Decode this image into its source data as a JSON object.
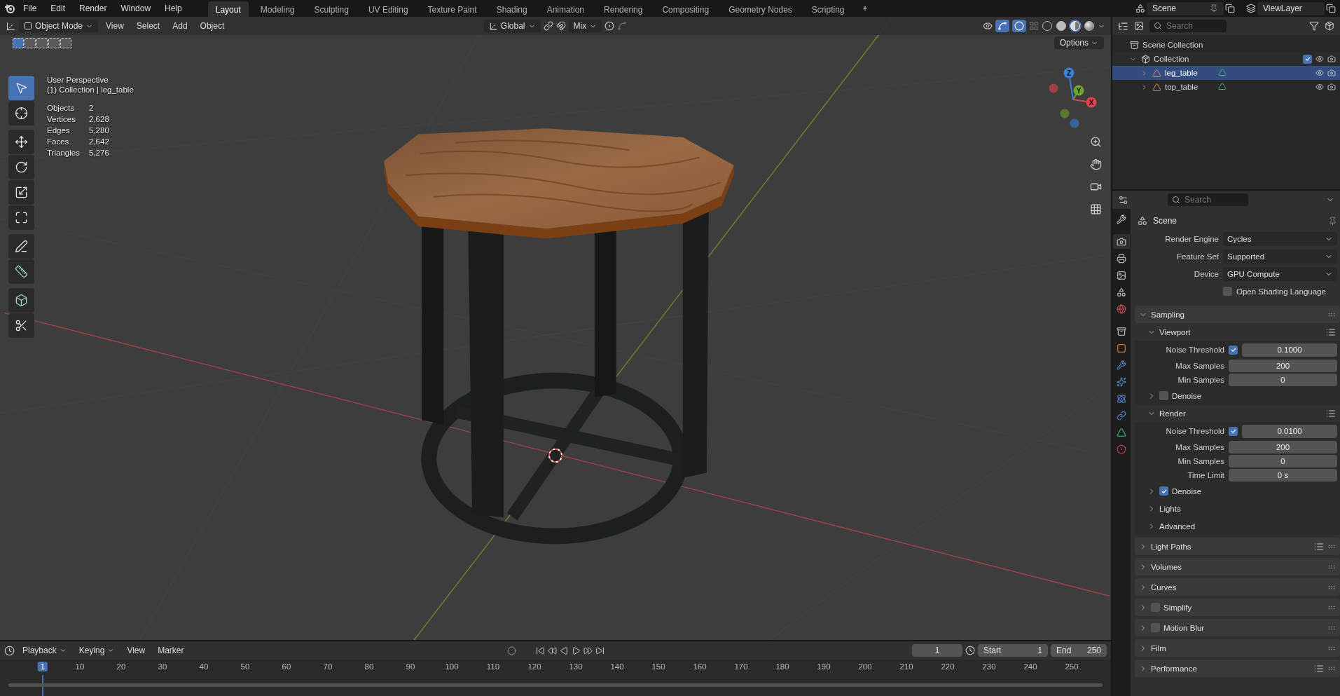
{
  "menu": [
    "File",
    "Edit",
    "Render",
    "Window",
    "Help"
  ],
  "workspaces": [
    {
      "label": "Layout",
      "selected": true
    },
    {
      "label": "Modeling",
      "selected": false
    },
    {
      "label": "Sculpting",
      "selected": false
    },
    {
      "label": "UV Editing",
      "selected": false
    },
    {
      "label": "Texture Paint",
      "selected": false
    },
    {
      "label": "Shading",
      "selected": false
    },
    {
      "label": "Animation",
      "selected": false
    },
    {
      "label": "Rendering",
      "selected": false
    },
    {
      "label": "Compositing",
      "selected": false
    },
    {
      "label": "Geometry Nodes",
      "selected": false
    },
    {
      "label": "Scripting",
      "selected": false
    }
  ],
  "add_workspace": "+",
  "scene_field": "Scene",
  "view_layer_field": "ViewLayer",
  "viewport": {
    "mode": "Object Mode",
    "menus": [
      "View",
      "Select",
      "Add",
      "Object"
    ],
    "orientation": "Global",
    "snap_mode": "Mix",
    "options": "Options",
    "select_modes": [
      {
        "selected": true
      },
      {
        "selected": false
      },
      {
        "selected": false
      },
      {
        "selected": false
      },
      {
        "selected": false
      }
    ],
    "shading": [
      {
        "kind": "wire",
        "selected": false
      },
      {
        "kind": "solid",
        "selected": false
      },
      {
        "kind": "material",
        "selected": true
      },
      {
        "kind": "rendered",
        "selected": false
      }
    ],
    "view_name": "User Perspective",
    "context": "(1) Collection | leg_table",
    "stats": [
      {
        "label": "Objects",
        "value": "2"
      },
      {
        "label": "Vertices",
        "value": "2,628"
      },
      {
        "label": "Edges",
        "value": "5,280"
      },
      {
        "label": "Faces",
        "value": "2,642"
      },
      {
        "label": "Triangles",
        "value": "5,276"
      }
    ],
    "tools": [
      {
        "kind": "select",
        "selected": true
      },
      {
        "kind": "cursor",
        "selected": false
      },
      {
        "kind": "move",
        "selected": false
      },
      {
        "kind": "rotate",
        "selected": false
      },
      {
        "kind": "scale",
        "selected": false
      },
      {
        "kind": "transform",
        "selected": false
      },
      {
        "kind": "annotate",
        "selected": false
      },
      {
        "kind": "measure",
        "selected": false
      },
      {
        "kind": "add_cube",
        "selected": false
      },
      {
        "kind": "cut",
        "selected": false
      }
    ],
    "gizmo_axes": [
      "X",
      "Y",
      "Z"
    ]
  },
  "outliner": {
    "search": {
      "placeholder": "Search"
    },
    "tree": [
      {
        "label": "Scene Collection",
        "kind": "scene_collection",
        "children": [
          {
            "label": "Collection",
            "kind": "collection",
            "expanded": true,
            "checked": true,
            "selected": false,
            "children": [
              {
                "label": "leg_table",
                "kind": "mesh",
                "expanded": false,
                "selected": true
              },
              {
                "label": "top_table",
                "kind": "mesh",
                "expanded": false,
                "selected": false
              }
            ]
          }
        ]
      }
    ]
  },
  "properties": {
    "search": {
      "placeholder": "Search"
    },
    "title": "Scene",
    "tabs": [
      {
        "kind": "tool",
        "selected": false
      },
      {
        "kind": "render",
        "selected": true
      },
      {
        "kind": "output",
        "selected": false
      },
      {
        "kind": "view_layer",
        "selected": false
      },
      {
        "kind": "scene",
        "selected": false
      },
      {
        "kind": "world",
        "selected": false
      },
      {
        "kind": "collection",
        "selected": false
      },
      {
        "kind": "object",
        "selected": false
      },
      {
        "kind": "modifiers",
        "selected": false
      },
      {
        "kind": "particles",
        "selected": false
      },
      {
        "kind": "physics",
        "selected": false
      },
      {
        "kind": "constraints",
        "selected": false
      },
      {
        "kind": "data",
        "selected": false
      },
      {
        "kind": "material",
        "selected": false
      }
    ],
    "settings": [
      {
        "kind": "dropdown",
        "label": "Render Engine",
        "value": "Cycles"
      },
      {
        "kind": "dropdown",
        "label": "Feature Set",
        "value": "Supported"
      },
      {
        "kind": "dropdown",
        "label": "Device",
        "value": "GPU Compute"
      },
      {
        "kind": "checkbox",
        "label": "Open Shading Language",
        "checked": false
      }
    ],
    "panels": [
      {
        "kind": "plain",
        "label": "Sampling",
        "expanded": true,
        "presets": false,
        "rows": [
          {
            "kind": "subheader",
            "label": "Viewport",
            "expanded": true
          },
          {
            "kind": "toggle_number",
            "label": "Noise Threshold",
            "checked": true,
            "value": "0.1000"
          },
          {
            "kind": "number",
            "label": "Max Samples",
            "value": "200"
          },
          {
            "kind": "number",
            "label": "Min Samples",
            "value": "0"
          },
          {
            "kind": "toggle_subpanel",
            "label": "Denoise",
            "checked": false,
            "expanded": false
          },
          {
            "kind": "subheader",
            "label": "Render",
            "expanded": true
          },
          {
            "kind": "toggle_number",
            "label": "Noise Threshold",
            "checked": true,
            "value": "0.0100"
          },
          {
            "kind": "number",
            "label": "Max Samples",
            "value": "200"
          },
          {
            "kind": "number",
            "label": "Min Samples",
            "value": "0"
          },
          {
            "kind": "number",
            "label": "Time Limit",
            "value": "0 s"
          },
          {
            "kind": "toggle_subpanel",
            "label": "Denoise",
            "checked": true,
            "expanded": false
          },
          {
            "kind": "subpanel",
            "label": "Lights",
            "expanded": false
          },
          {
            "kind": "subpanel",
            "label": "Advanced",
            "expanded": false
          }
        ]
      },
      {
        "kind": "plain",
        "label": "Light Paths",
        "expanded": false,
        "presets": true
      },
      {
        "kind": "plain",
        "label": "Volumes",
        "expanded": false,
        "presets": false
      },
      {
        "kind": "plain",
        "label": "Curves",
        "expanded": false,
        "presets": false
      },
      {
        "kind": "toggle",
        "label": "Simplify",
        "checked": false,
        "expanded": false,
        "presets": false
      },
      {
        "kind": "toggle",
        "label": "Motion Blur",
        "checked": false,
        "expanded": false,
        "presets": false
      },
      {
        "kind": "plain",
        "label": "Film",
        "expanded": false,
        "presets": false
      },
      {
        "kind": "plain",
        "label": "Performance",
        "expanded": false,
        "presets": true
      }
    ]
  },
  "timeline": {
    "menus": [
      "Playback",
      "Keying",
      "View",
      "Marker"
    ],
    "current_frame": "1",
    "start_label": "Start",
    "start": "1",
    "end_label": "End",
    "end": "250",
    "ruler": [
      {
        "label": "1",
        "selected": true
      },
      {
        "label": "10",
        "selected": false
      },
      {
        "label": "20",
        "selected": false
      },
      {
        "label": "30",
        "selected": false
      },
      {
        "label": "40",
        "selected": false
      },
      {
        "label": "50",
        "selected": false
      },
      {
        "label": "60",
        "selected": false
      },
      {
        "label": "70",
        "selected": false
      },
      {
        "label": "80",
        "selected": false
      },
      {
        "label": "90",
        "selected": false
      },
      {
        "label": "100",
        "selected": false
      },
      {
        "label": "110",
        "selected": false
      },
      {
        "label": "120",
        "selected": false
      },
      {
        "label": "130",
        "selected": false
      },
      {
        "label": "140",
        "selected": false
      },
      {
        "label": "150",
        "selected": false
      },
      {
        "label": "160",
        "selected": false
      },
      {
        "label": "170",
        "selected": false
      },
      {
        "label": "180",
        "selected": false
      },
      {
        "label": "190",
        "selected": false
      },
      {
        "label": "200",
        "selected": false
      },
      {
        "label": "210",
        "selected": false
      },
      {
        "label": "220",
        "selected": false
      },
      {
        "label": "230",
        "selected": false
      },
      {
        "label": "240",
        "selected": false
      },
      {
        "label": "250",
        "selected": false
      }
    ]
  }
}
